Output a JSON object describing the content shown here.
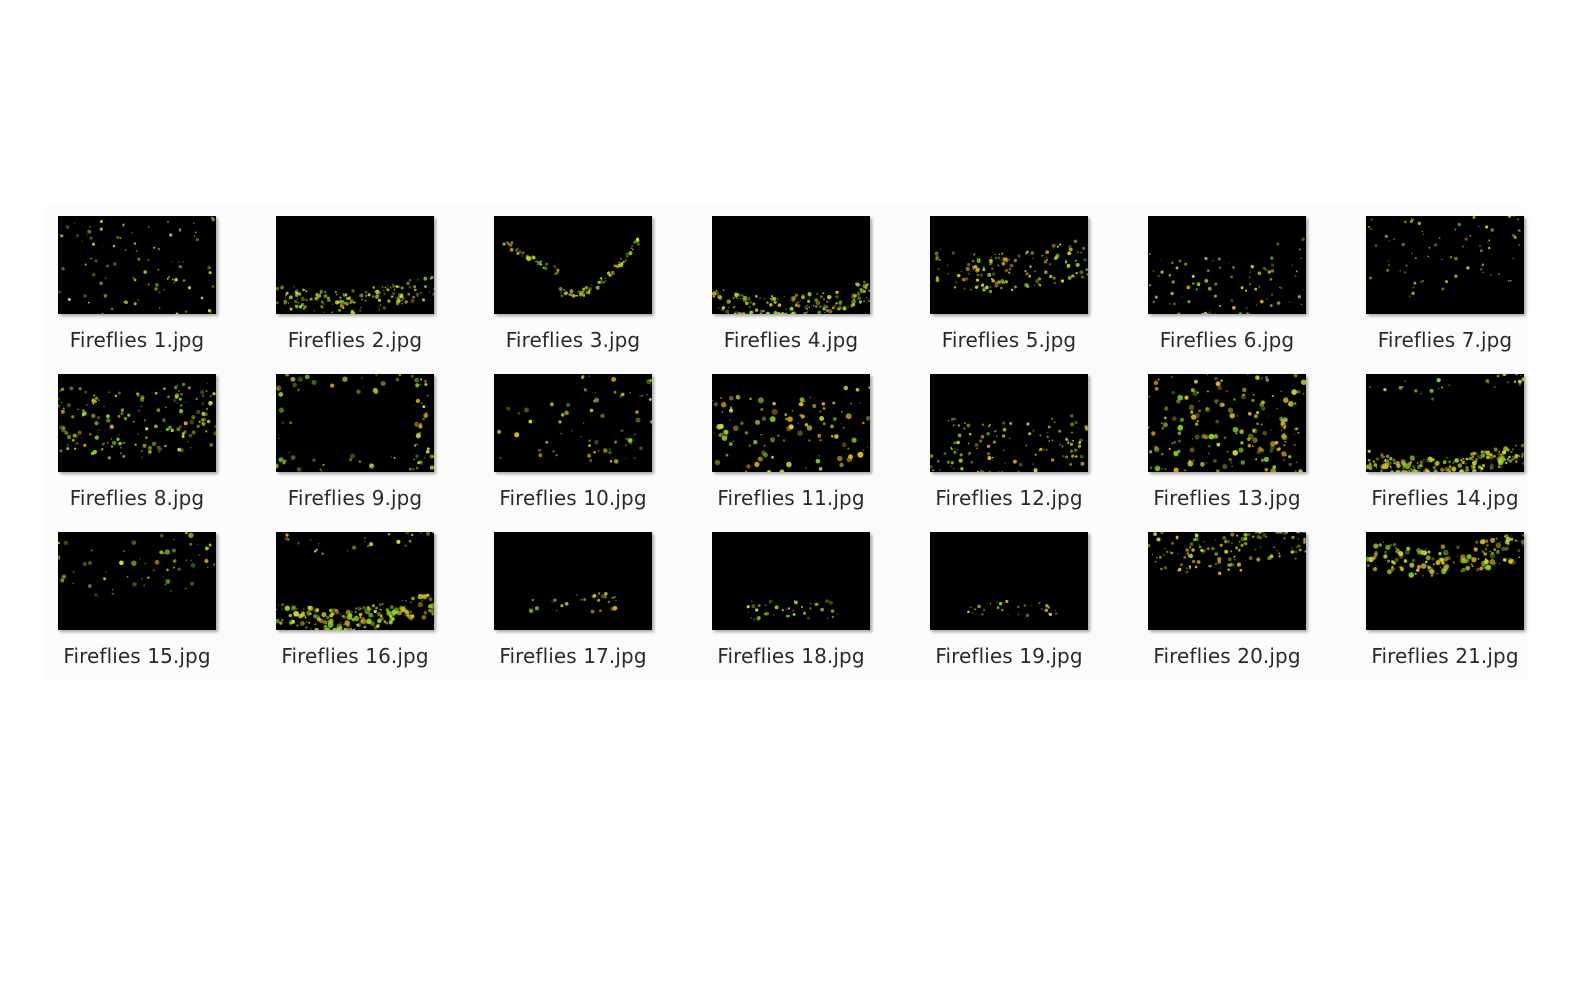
{
  "explorer": {
    "files": [
      {
        "name": "Fireflies 1.jpg"
      },
      {
        "name": "Fireflies 2.jpg"
      },
      {
        "name": "Fireflies 3.jpg"
      },
      {
        "name": "Fireflies 4.jpg"
      },
      {
        "name": "Fireflies 5.jpg"
      },
      {
        "name": "Fireflies 6.jpg"
      },
      {
        "name": "Fireflies 7.jpg"
      },
      {
        "name": "Fireflies 8.jpg"
      },
      {
        "name": "Fireflies 9.jpg"
      },
      {
        "name": "Fireflies 10.jpg"
      },
      {
        "name": "Fireflies 11.jpg"
      },
      {
        "name": "Fireflies 12.jpg"
      },
      {
        "name": "Fireflies 13.jpg"
      },
      {
        "name": "Fireflies 14.jpg"
      },
      {
        "name": "Fireflies 15.jpg"
      },
      {
        "name": "Fireflies 16.jpg"
      },
      {
        "name": "Fireflies 17.jpg"
      },
      {
        "name": "Fireflies 18.jpg"
      },
      {
        "name": "Fireflies 19.jpg"
      },
      {
        "name": "Fireflies 20.jpg"
      },
      {
        "name": "Fireflies 21.jpg"
      }
    ],
    "colors": {
      "thumb_background": "#000000",
      "firefly_glow": "#c8d832",
      "firefly_gold": "#e0b020",
      "firefly_green": "#7ed321"
    }
  }
}
